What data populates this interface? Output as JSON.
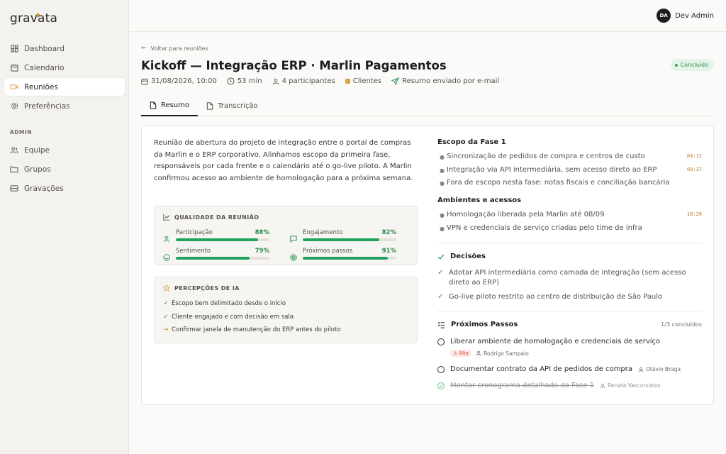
{
  "app": {
    "logo": "gravata"
  },
  "user": {
    "initials": "DA",
    "name": "Dev Admin"
  },
  "sidebar": {
    "items": [
      {
        "label": "Dashboard"
      },
      {
        "label": "Calendario"
      },
      {
        "label": "Reuniões"
      },
      {
        "label": "Preferências"
      }
    ],
    "admin_section": "ADMIN",
    "admin_items": [
      {
        "label": "Equipe"
      },
      {
        "label": "Grupos"
      },
      {
        "label": "Gravações"
      }
    ]
  },
  "page": {
    "back": "Voltar para reuniões",
    "title": "Kickoff — Integração ERP · Marlin Pagamentos",
    "status": "Concluído",
    "meta": {
      "datetime": "31/08/2026, 10:00",
      "duration": "53 min",
      "participants": "4 participantes",
      "group": "Clientes",
      "email": "Resumo enviado por e-mail"
    },
    "tabs": [
      "Resumo",
      "Transcrição"
    ]
  },
  "summary": "Reunião de abertura do projeto de integração entre o portal de compras da Marlin e o ERP corporativo. Alinhamos escopo da primeira fase, responsáveis por cada frente e o calendário até o go-live piloto. A Marlin confirmou acesso ao ambiente de homologação para a próxima semana.",
  "quality": {
    "title": "QUALIDADE DA REUNIÃO",
    "metrics": [
      {
        "label": "Participação",
        "value": "88%",
        "pct": 88
      },
      {
        "label": "Engajamento",
        "value": "82%",
        "pct": 82
      },
      {
        "label": "Sentimento",
        "value": "79%",
        "pct": 79
      },
      {
        "label": "Próximos passos",
        "value": "91%",
        "pct": 91
      }
    ]
  },
  "insights": {
    "title": "PERCEPÇÕES DE IA",
    "items": [
      {
        "text": "Escopo bem delimitado desde o início",
        "kind": "ok"
      },
      {
        "text": "Cliente engajado e com decisão em sala",
        "kind": "ok"
      },
      {
        "text": "Confirmar janela de manutenção do ERP antes do piloto",
        "kind": "warn"
      }
    ]
  },
  "scope": {
    "title": "Escopo da Fase 1",
    "items": [
      {
        "text": "Sincronização de pedidos de compra e centros de custo",
        "ts": "04:12"
      },
      {
        "text": "Integração via API intermediária, sem acesso direto ao ERP",
        "ts": "09:37"
      },
      {
        "text": "Fora de escopo nesta fase: notas fiscais e conciliação bancária",
        "ts": ""
      }
    ]
  },
  "envs": {
    "title": "Ambientes e acessos",
    "items": [
      {
        "text": "Homologação liberada pela Marlin até 08/09",
        "ts": "18:20"
      },
      {
        "text": "VPN e credenciais de serviço criadas pelo time de infra",
        "ts": ""
      }
    ]
  },
  "decisions": {
    "title": "Decisões",
    "items": [
      {
        "text": "Adotar API intermediária como camada de integração (sem acesso direto ao ERP)"
      },
      {
        "text": "Go-live piloto restrito ao centro de distribuição de São Paulo"
      }
    ]
  },
  "next_steps": {
    "title": "Próximos Passos",
    "count": "1/3 concluídos",
    "items": [
      {
        "text": "Liberar ambiente de homologação e credenciais de serviço",
        "priority": "Alta",
        "assignee": "Rodrigo Sampaio",
        "done": false
      },
      {
        "text": "Documentar contrato da API de pedidos de compra",
        "assignee": "Otávio Braga",
        "done": false
      },
      {
        "text": "Montar cronograma detalhado da Fase 1",
        "assignee": "Renata Vasconcelos",
        "done": true
      }
    ]
  },
  "colors": {
    "accent": "#1fa35c",
    "brand": "#d4a24a",
    "status_bg": "#e3f5e9",
    "priority": "#d23a2e"
  }
}
